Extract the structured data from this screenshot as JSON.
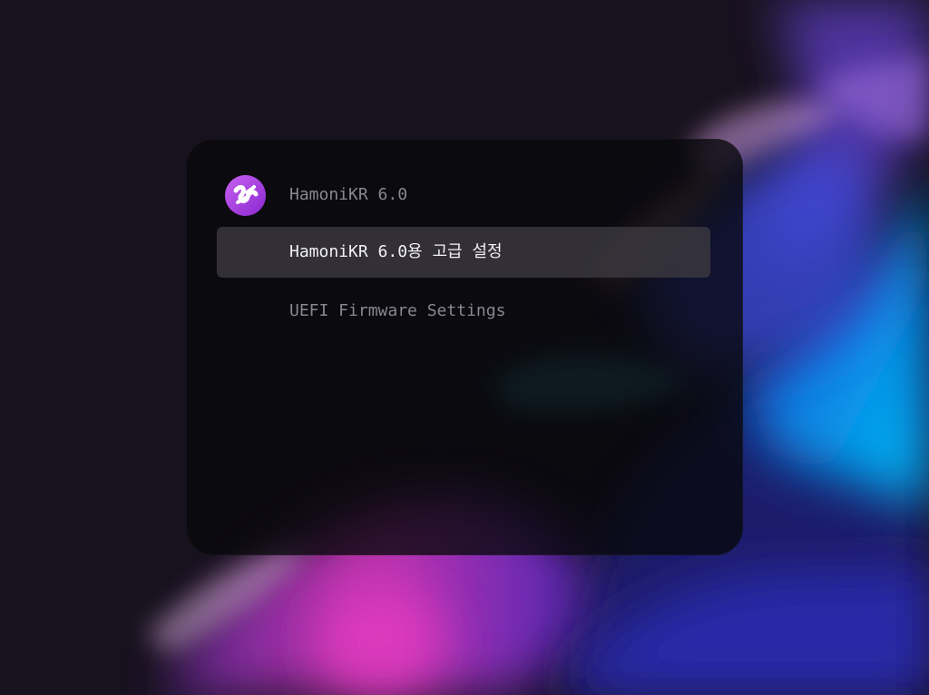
{
  "boot_menu": {
    "entries": [
      {
        "label": "HamoniKR 6.0",
        "icon": "hamonikr-logo-icon",
        "selected": false
      },
      {
        "label": "HamoniKR 6.0용 고급 설정",
        "selected": true
      },
      {
        "label": "UEFI Firmware Settings",
        "selected": false
      }
    ]
  },
  "colors": {
    "panel_background": "#0a0a0e",
    "selected_background": "#3a3840",
    "text_normal": "#8a8790",
    "text_selected": "#f2f1f5",
    "logo_purple": "#b040e0"
  }
}
